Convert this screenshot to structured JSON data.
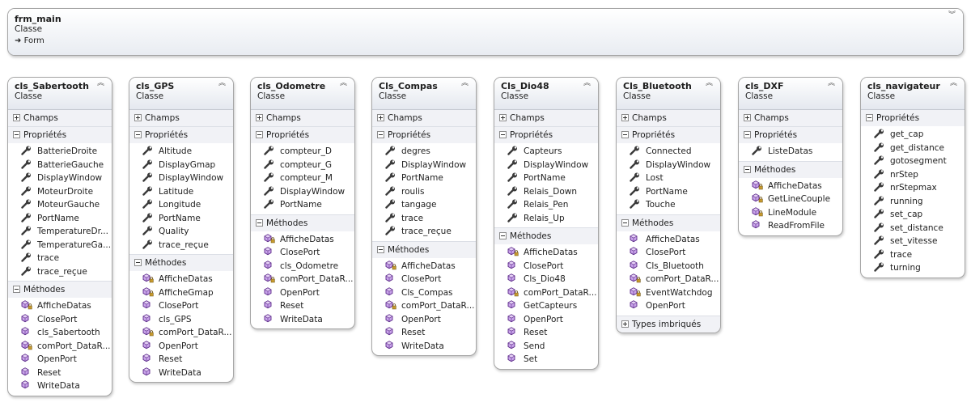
{
  "main_class": {
    "name": "frm_main",
    "kind": "Classe",
    "base": "Form",
    "base_arrow": "➜"
  },
  "labels": {
    "fields": "Champs",
    "properties": "Propriétés",
    "methods": "Méthodes",
    "nested_types": "Types imbriqués"
  },
  "classes": [
    {
      "name": "cls_Sabertooth",
      "kind": "Classe",
      "fields": true,
      "properties": [
        "BatterieDroite",
        "BatterieGauche",
        "DisplayWindow",
        "MoteurDroite",
        "MoteurGauche",
        "PortName",
        "TemperatureDr...",
        "TemperatureGa...",
        "trace",
        "trace_reçue"
      ],
      "methods": [
        {
          "label": "AfficheDatas",
          "icon": "method-private"
        },
        {
          "label": "ClosePort",
          "icon": "method"
        },
        {
          "label": "cls_Sabertooth",
          "icon": "method"
        },
        {
          "label": "comPort_DataR...",
          "icon": "method-private"
        },
        {
          "label": "OpenPort",
          "icon": "method"
        },
        {
          "label": "Reset",
          "icon": "method"
        },
        {
          "label": "WriteData",
          "icon": "method"
        }
      ],
      "nested": false
    },
    {
      "name": "cls_GPS",
      "kind": "Classe",
      "fields": true,
      "properties": [
        "Altitude",
        "DisplayGmap",
        "DisplayWindow",
        "Latitude",
        "Longitude",
        "PortName",
        "Quality",
        "trace_reçue"
      ],
      "methods": [
        {
          "label": "AfficheDatas",
          "icon": "method-private"
        },
        {
          "label": "AfficheGmap",
          "icon": "method-private"
        },
        {
          "label": "ClosePort",
          "icon": "method"
        },
        {
          "label": "cls_GPS",
          "icon": "method"
        },
        {
          "label": "comPort_DataR...",
          "icon": "method-private"
        },
        {
          "label": "OpenPort",
          "icon": "method"
        },
        {
          "label": "Reset",
          "icon": "method"
        },
        {
          "label": "WriteData",
          "icon": "method"
        }
      ],
      "nested": false
    },
    {
      "name": "cls_Odometre",
      "kind": "Classe",
      "fields": true,
      "properties": [
        "compteur_D",
        "compteur_G",
        "compteur_M",
        "DisplayWindow",
        "PortName"
      ],
      "methods": [
        {
          "label": "AfficheDatas",
          "icon": "method-private"
        },
        {
          "label": "ClosePort",
          "icon": "method"
        },
        {
          "label": "cls_Odometre",
          "icon": "method"
        },
        {
          "label": "comPort_DataR...",
          "icon": "method-private"
        },
        {
          "label": "OpenPort",
          "icon": "method"
        },
        {
          "label": "Reset",
          "icon": "method"
        },
        {
          "label": "WriteData",
          "icon": "method"
        }
      ],
      "nested": false
    },
    {
      "name": "Cls_Compas",
      "kind": "Classe",
      "fields": true,
      "properties": [
        "degres",
        "DisplayWindow",
        "PortName",
        "roulis",
        "tangage",
        "trace",
        "trace_reçue"
      ],
      "methods": [
        {
          "label": "AfficheDatas",
          "icon": "method-private"
        },
        {
          "label": "ClosePort",
          "icon": "method"
        },
        {
          "label": "Cls_Compas",
          "icon": "method"
        },
        {
          "label": "comPort_DataR...",
          "icon": "method-private"
        },
        {
          "label": "OpenPort",
          "icon": "method"
        },
        {
          "label": "Reset",
          "icon": "method"
        },
        {
          "label": "WriteData",
          "icon": "method"
        }
      ],
      "nested": false
    },
    {
      "name": "Cls_Dio48",
      "kind": "Classe",
      "fields": true,
      "properties": [
        "Capteurs",
        "DisplayWindow",
        "PortName",
        "Relais_Down",
        "Relais_Pen",
        "Relais_Up"
      ],
      "methods": [
        {
          "label": "AfficheDatas",
          "icon": "method-private"
        },
        {
          "label": "ClosePort",
          "icon": "method"
        },
        {
          "label": "Cls_Dio48",
          "icon": "method"
        },
        {
          "label": "comPort_DataR...",
          "icon": "method-private"
        },
        {
          "label": "GetCapteurs",
          "icon": "method"
        },
        {
          "label": "OpenPort",
          "icon": "method"
        },
        {
          "label": "Reset",
          "icon": "method"
        },
        {
          "label": "Send",
          "icon": "method"
        },
        {
          "label": "Set",
          "icon": "method"
        }
      ],
      "nested": false
    },
    {
      "name": "Cls_Bluetooth",
      "kind": "Classe",
      "fields": true,
      "properties": [
        "Connected",
        "DisplayWindow",
        "Lost",
        "PortName",
        "Touche"
      ],
      "methods": [
        {
          "label": "AfficheDatas",
          "icon": "method"
        },
        {
          "label": "ClosePort",
          "icon": "method"
        },
        {
          "label": "Cls_Bluetooth",
          "icon": "method"
        },
        {
          "label": "comPort_DataR...",
          "icon": "method-private"
        },
        {
          "label": "EventWatchdog",
          "icon": "method-private"
        },
        {
          "label": "OpenPort",
          "icon": "method"
        }
      ],
      "nested": true
    },
    {
      "name": "cls_DXF",
      "kind": "Classe",
      "fields": true,
      "properties": [
        "ListeDatas"
      ],
      "methods": [
        {
          "label": "AfficheDatas",
          "icon": "method-private"
        },
        {
          "label": "GetLineCouple",
          "icon": "method-private"
        },
        {
          "label": "LineModule",
          "icon": "method-private"
        },
        {
          "label": "ReadFromFile",
          "icon": "method"
        }
      ],
      "nested": false
    },
    {
      "name": "cls_navigateur",
      "kind": "Classe",
      "fields": false,
      "properties": [
        "get_cap",
        "get_distance",
        "gotosegment",
        "nrStep",
        "nrStepmax",
        "running",
        "set_cap",
        "set_distance",
        "set_vitesse",
        "trace",
        "turning"
      ],
      "methods": [],
      "nested": false
    }
  ],
  "colors": {
    "method_fill": "#9b4fcf",
    "method_stroke": "#5c2a8a",
    "lock": "#c79a2e",
    "wrench": "#3a3a3a"
  }
}
